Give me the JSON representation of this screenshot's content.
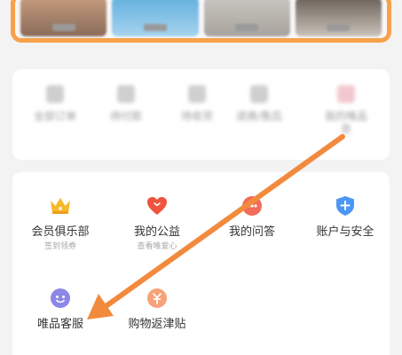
{
  "top_banner": {
    "thumbnails": [
      {
        "bg": "linear-gradient(180deg,#c49b7e,#8a6a58)"
      },
      {
        "bg": "linear-gradient(180deg,#64b0df,#a6d3ee)"
      },
      {
        "bg": "linear-gradient(180deg,#c8c5c0,#a8a39c)"
      },
      {
        "bg": "linear-gradient(180deg,#6b625a,#c9c2b8)"
      }
    ]
  },
  "middle_row": [
    {
      "label": "全部订单"
    },
    {
      "label": "待付款"
    },
    {
      "label": "待收货"
    },
    {
      "label": "退换/售后"
    },
    {
      "label": "我的唯品\n会"
    }
  ],
  "services": {
    "row1": [
      {
        "label": "会员俱乐部",
        "sub": "签到领券",
        "icon": "crown-icon"
      },
      {
        "label": "我的公益",
        "sub": "查看唯爱心",
        "icon": "heart-icon"
      },
      {
        "label": "我的问答",
        "sub": "",
        "icon": "qa-icon"
      },
      {
        "label": "账户与安全",
        "sub": "",
        "icon": "shield-icon"
      }
    ],
    "row2": [
      {
        "label": "唯品客服",
        "icon": "customer-service-icon"
      },
      {
        "label": "购物返津贴",
        "icon": "allowance-icon"
      }
    ]
  },
  "colors": {
    "accent_orange": "#f8a14a",
    "arrow": "#f28a3d",
    "crown": "#f6b92a",
    "heart": "#f0533e",
    "shield": "#4b97f5",
    "service": "#8b87e6",
    "allowance": "#f7a27a"
  }
}
